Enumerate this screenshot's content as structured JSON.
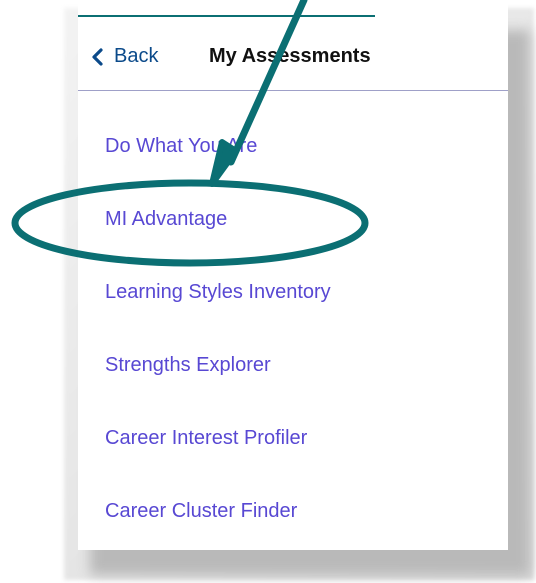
{
  "header": {
    "back_label": "Back",
    "title": "My Assessments"
  },
  "menu": {
    "items": [
      {
        "label": "Do What You Are"
      },
      {
        "label": "MI Advantage"
      },
      {
        "label": "Learning Styles Inventory"
      },
      {
        "label": "Strengths Explorer"
      },
      {
        "label": "Career Interest Profiler"
      },
      {
        "label": "Career Cluster Finder"
      }
    ]
  },
  "colors": {
    "link": "#5848d3",
    "back": "#0b4a8a",
    "annotation": "#0b6f73",
    "header_border": "#9fa0c8"
  },
  "annotation": {
    "highlighted_item": "MI Advantage",
    "arrow_icon": "arrow-icon",
    "ellipse_icon": "ellipse-highlight"
  }
}
